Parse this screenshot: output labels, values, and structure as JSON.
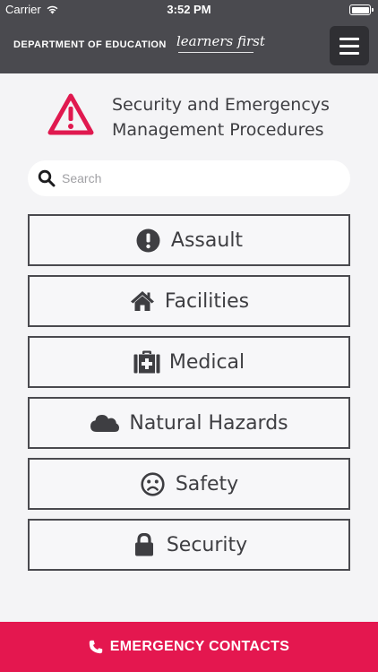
{
  "status_bar": {
    "carrier": "Carrier",
    "time": "3:52 PM"
  },
  "header": {
    "department": "DEPARTMENT OF EDUCATION",
    "tagline": "learners first",
    "menu_icon": "hamburger-menu-icon"
  },
  "title": {
    "line1": "Security and Emergencys",
    "line2": "Management Procedures",
    "icon": "warning-triangle-icon",
    "icon_color": "#e0194f"
  },
  "search": {
    "placeholder": "Search",
    "value": ""
  },
  "categories": [
    {
      "label": "Assault",
      "icon": "exclamation-circle-icon"
    },
    {
      "label": "Facilities",
      "icon": "home-icon"
    },
    {
      "label": "Medical",
      "icon": "medkit-icon"
    },
    {
      "label": "Natural Hazards",
      "icon": "cloud-icon"
    },
    {
      "label": "Safety",
      "icon": "frown-face-icon"
    },
    {
      "label": "Security",
      "icon": "lock-icon"
    }
  ],
  "emergency": {
    "label": "EMERGENCY CONTACTS",
    "icon": "phone-icon",
    "color": "#e4174f"
  },
  "colors": {
    "header_bg": "#4a4a4f",
    "page_bg": "#f4f4f6",
    "text": "#3e3e42"
  }
}
